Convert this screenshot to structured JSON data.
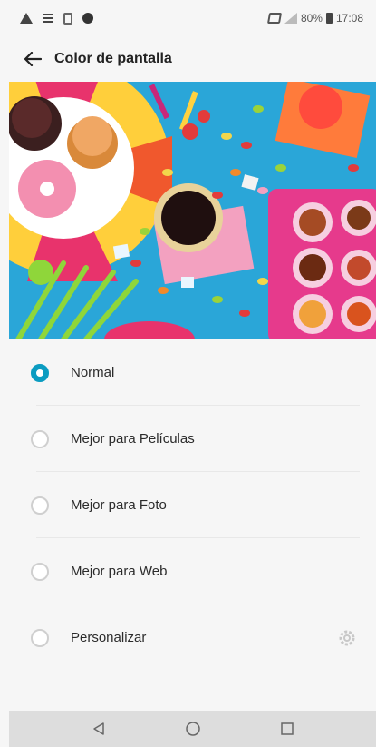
{
  "status": {
    "battery": "80%",
    "time": "17:08"
  },
  "header": {
    "title": "Color de pantalla"
  },
  "options": [
    {
      "label": "Normal",
      "selected": true
    },
    {
      "label": "Mejor para Películas",
      "selected": false
    },
    {
      "label": "Mejor para Foto",
      "selected": false
    },
    {
      "label": "Mejor para Web",
      "selected": false
    },
    {
      "label": "Personalizar",
      "selected": false,
      "has_settings": true
    }
  ],
  "icons": {
    "back": "arrow-left-icon",
    "settings": "gear-icon",
    "nav_back": "triangle-back-icon",
    "nav_home": "circle-home-icon",
    "nav_recents": "square-recents-icon"
  },
  "colors": {
    "accent": "#0b9cc1",
    "background": "#f6f6f6",
    "hero_background": "#2aa6d8",
    "navbar": "#dddddd"
  }
}
